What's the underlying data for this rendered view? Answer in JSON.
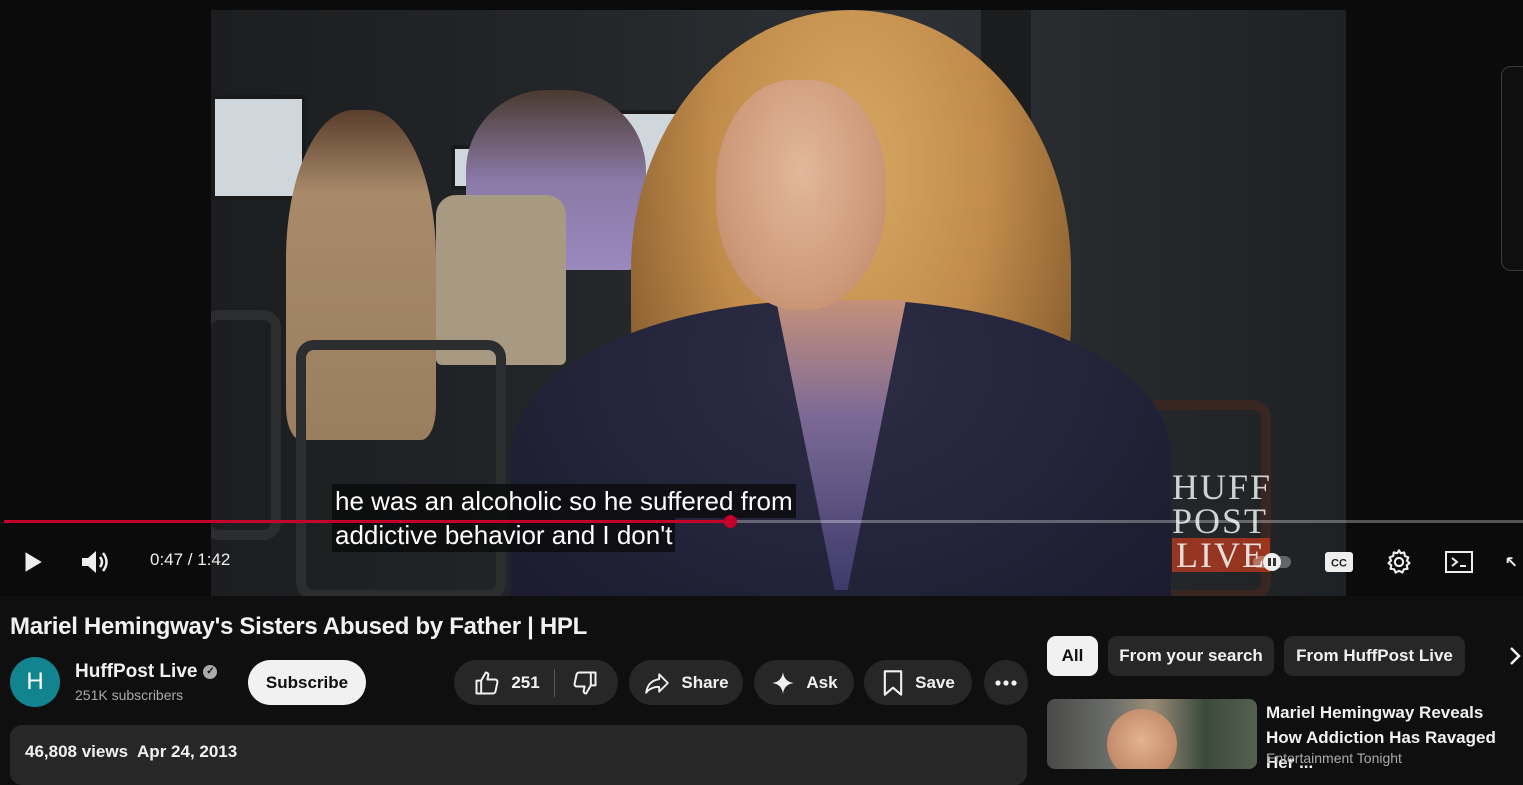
{
  "player": {
    "caption_line1": "he was an alcoholic so he suffered from",
    "caption_line2": "addictive behavior and I don't",
    "time": "0:47 / 1:42",
    "progress_fraction": 0.478,
    "overlay_logo": {
      "line1": "HUFF",
      "line2": "POST",
      "line3": "LIVE"
    },
    "icons": {
      "play": "play-icon",
      "volume": "volume-icon",
      "autoplay": "autoplay-toggle-icon",
      "captions": "cc-icon",
      "settings": "gear-icon",
      "miniplayer": "miniplayer-icon",
      "fullscreen": "fullscreen-icon"
    }
  },
  "video": {
    "title": "Mariel Hemingway's Sisters Abused by Father | HPL",
    "channel_name": "HuffPost Live",
    "avatar_letter": "H",
    "subscribers": "251K subscribers",
    "subscribe_label": "Subscribe",
    "likes": "251",
    "share_label": "Share",
    "ask_label": "Ask",
    "save_label": "Save",
    "views": "46,808 views",
    "date": "Apr 24, 2013"
  },
  "chips": [
    {
      "label": "All",
      "active": true
    },
    {
      "label": "From your search",
      "active": false
    },
    {
      "label": "From HuffPost Live",
      "active": false
    }
  ],
  "recommendation": {
    "title": "Mariel Hemingway Reveals How Addiction Has Ravaged Her ...",
    "channel": "Entertainment Tonight"
  },
  "colors": {
    "background": "#0f0f0f",
    "progress": "#c4002a",
    "pill": "#272727",
    "subscribe_bg": "#f1f1f1",
    "avatar": "#12848f"
  }
}
